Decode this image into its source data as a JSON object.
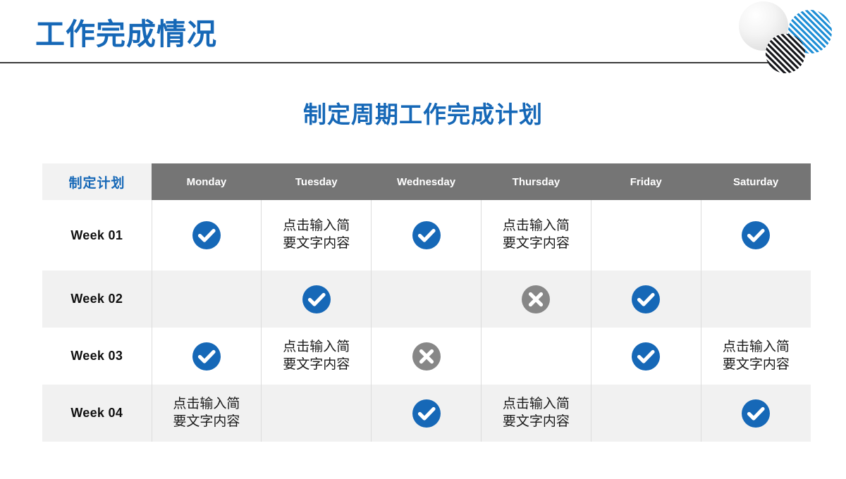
{
  "header": {
    "title": "工作完成情况"
  },
  "subtitle": "制定周期工作完成计划",
  "colors": {
    "brand_blue": "#1668b7",
    "header_gray": "#757575",
    "corner_bg": "#f2f2f2",
    "row_alt_bg": "#f1f1f1",
    "check_blue": "#1668b7",
    "cross_gray": "#878787",
    "rule_dark": "#3a3a3a",
    "stripe_blue": "#1f8fd6",
    "stripe_dark": "#17181c"
  },
  "table": {
    "corner_label": "制定计划",
    "columns": [
      "Monday",
      "Tuesday",
      "Wednesday",
      "Thursday",
      "Friday",
      "Saturday"
    ],
    "placeholder_text": "点击输入简\n要文字内容",
    "rows": [
      {
        "label": "Week 01",
        "cells": [
          {
            "type": "check"
          },
          {
            "type": "text",
            "text": "点击输入简\n要文字内容"
          },
          {
            "type": "check"
          },
          {
            "type": "text",
            "text": "点击输入简\n要文字内容"
          },
          {
            "type": "empty"
          },
          {
            "type": "check"
          }
        ]
      },
      {
        "label": "Week 02",
        "cells": [
          {
            "type": "empty"
          },
          {
            "type": "check"
          },
          {
            "type": "empty"
          },
          {
            "type": "cross"
          },
          {
            "type": "check"
          },
          {
            "type": "empty"
          }
        ]
      },
      {
        "label": "Week 03",
        "cells": [
          {
            "type": "check"
          },
          {
            "type": "text",
            "text": "点击输入简\n要文字内容"
          },
          {
            "type": "cross"
          },
          {
            "type": "empty"
          },
          {
            "type": "check"
          },
          {
            "type": "text",
            "text": "点击输入简\n要文字内容"
          }
        ]
      },
      {
        "label": "Week 04",
        "cells": [
          {
            "type": "text",
            "text": "点击输入简\n要文字内容"
          },
          {
            "type": "empty"
          },
          {
            "type": "check"
          },
          {
            "type": "text",
            "text": "点击输入简\n要文字内容"
          },
          {
            "type": "empty"
          },
          {
            "type": "check"
          }
        ]
      }
    ]
  },
  "icons": {
    "check": "check-circle-icon",
    "cross": "cross-circle-icon",
    "deco_gray": "gradient-circle-decoration",
    "deco_blue": "blue-striped-circle-decoration",
    "deco_dark": "dark-striped-circle-decoration"
  }
}
